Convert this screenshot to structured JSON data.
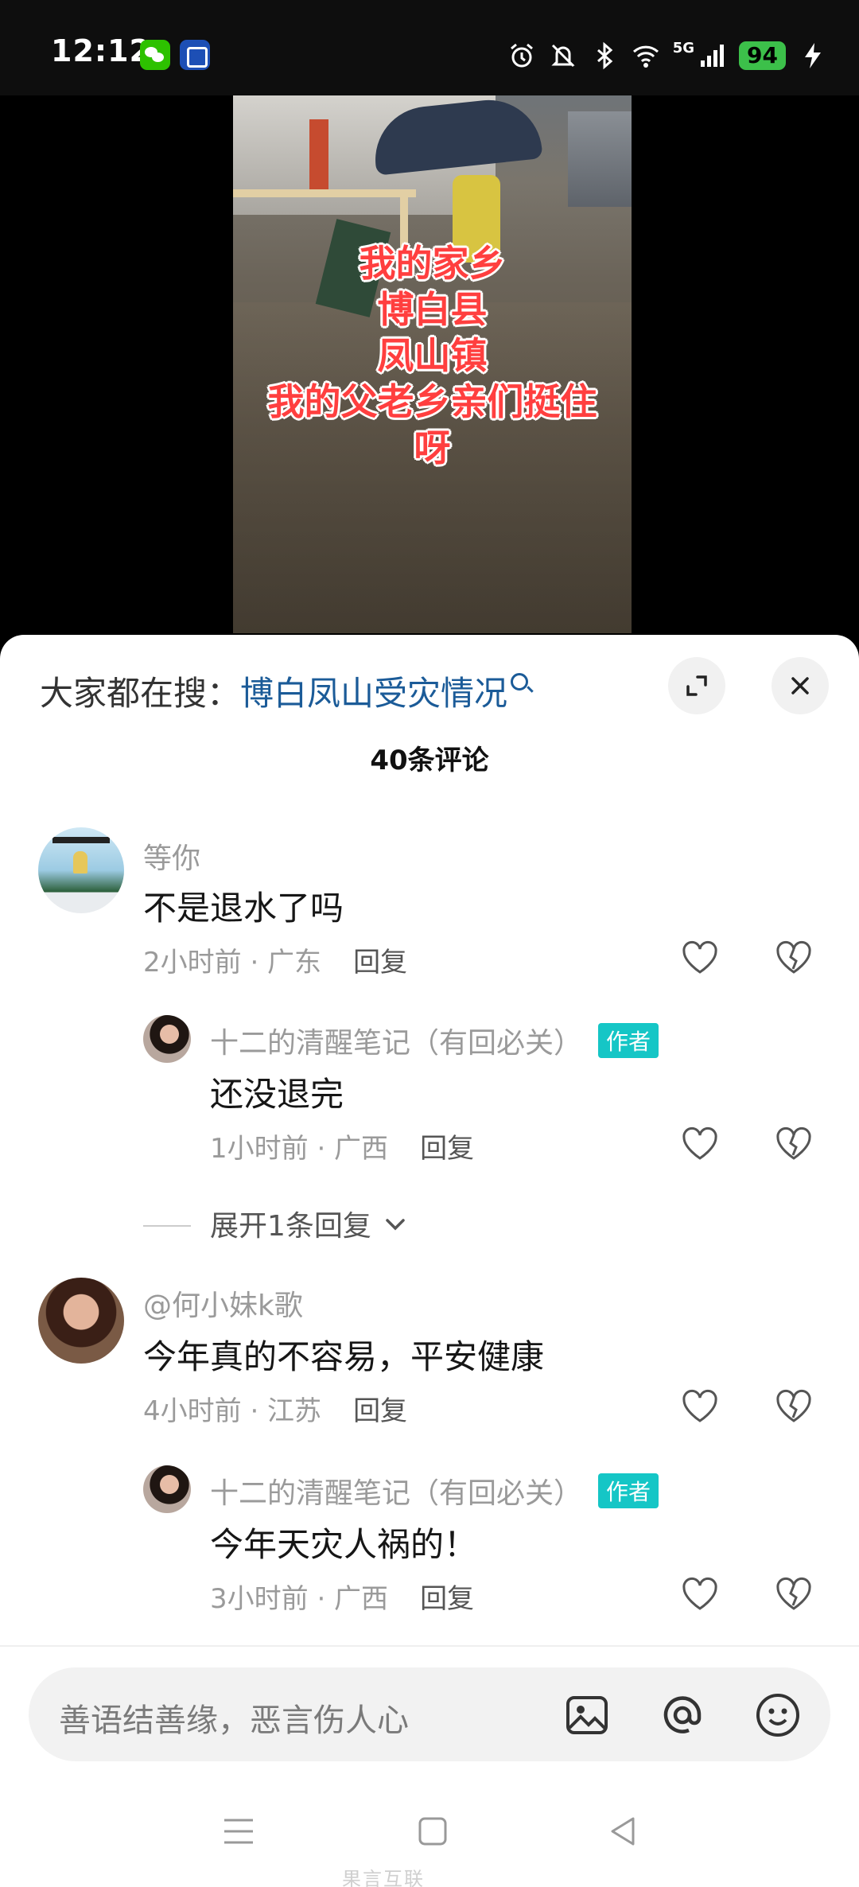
{
  "status_bar": {
    "time": "12:12",
    "network": "5G",
    "battery": "94"
  },
  "video": {
    "caption_lines": [
      "我的家乡",
      "博白县",
      "凤山镇",
      "我的父老乡亲们挺住",
      "呀"
    ]
  },
  "sheet": {
    "search_prefix": "大家都在搜：",
    "search_keyword": "博白凤山受灾情况",
    "comment_count_title": "40条评论"
  },
  "comments": [
    {
      "name": "等你",
      "text": "不是退水了吗",
      "meta": "2小时前 · 广东",
      "reply_label": "回复",
      "replies": [
        {
          "name": "十二的清醒笔记（有回必关）",
          "badge": "作者",
          "text": "还没退完",
          "meta": "1小时前 · 广西",
          "reply_label": "回复"
        }
      ],
      "expand_label": "展开1条回复"
    },
    {
      "name": "@何小妹k歌",
      "text": "今年真的不容易，平安健康",
      "meta": "4小时前 · 江苏",
      "reply_label": "回复",
      "replies": [
        {
          "name": "十二的清醒笔记（有回必关）",
          "badge": "作者",
          "text": "今年天灾人祸的！",
          "meta": "3小时前 · 广西",
          "reply_label": "回复"
        }
      ]
    }
  ],
  "input": {
    "placeholder": "善语结善缘，恶言伤人心"
  },
  "icons": {
    "expand": "expand-icon",
    "close": "close-icon",
    "like": "heart-icon",
    "dislike": "broken-heart-icon",
    "image": "image-icon",
    "mention": "at-icon",
    "emoji": "emoji-icon"
  },
  "colors": {
    "search_keyword": "#1b5b98",
    "author_badge": "#15c6c6",
    "caption": "#ff3f3f"
  },
  "watermark": "果言互联"
}
